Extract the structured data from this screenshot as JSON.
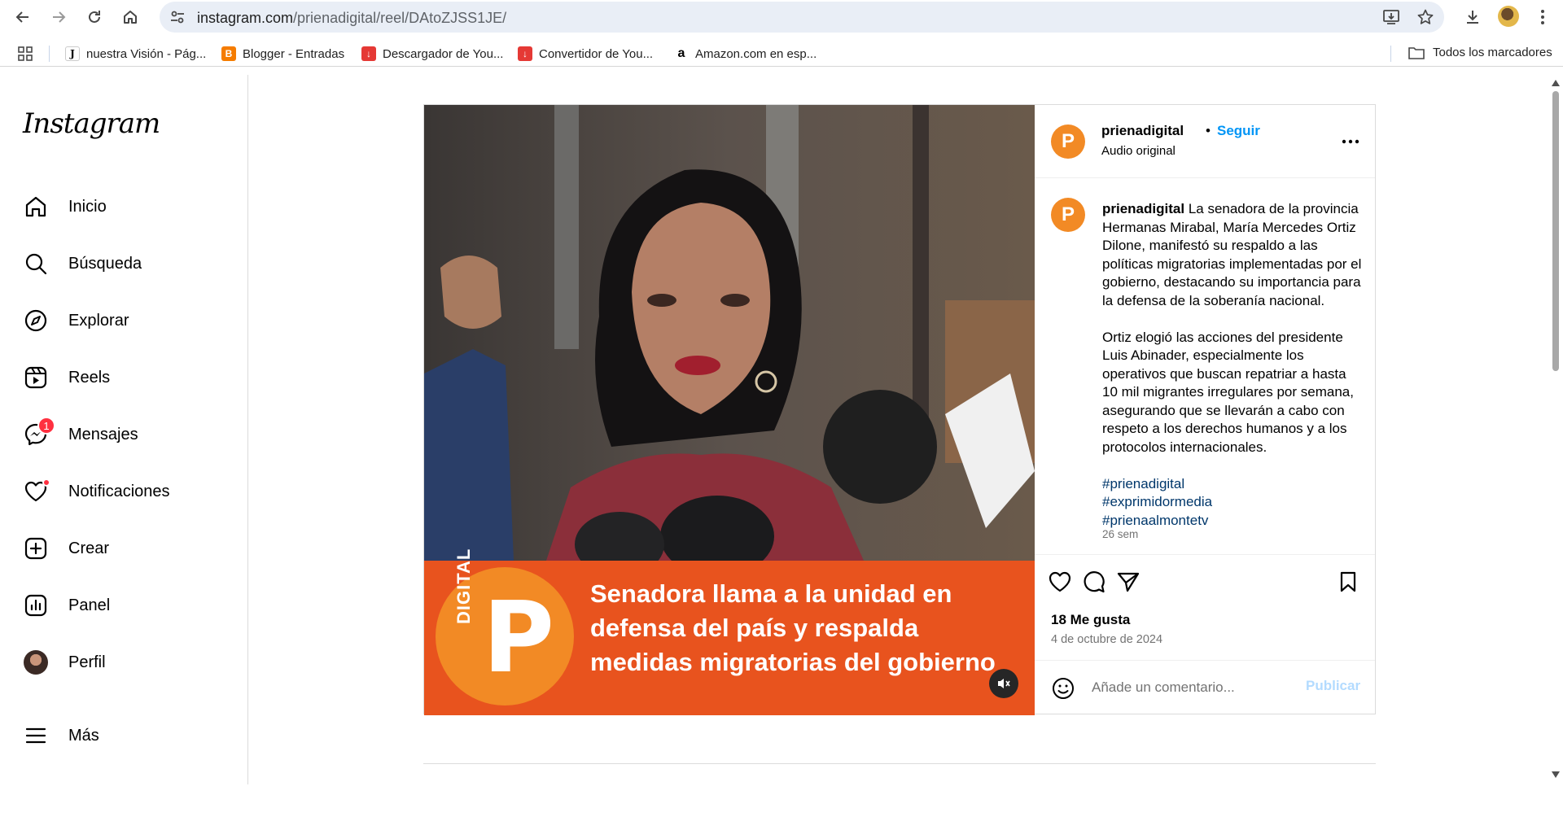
{
  "browser": {
    "url_domain": "instagram.com",
    "url_path": "/prienadigital/reel/DAtoZJSS1JE/",
    "bookmarks": [
      {
        "label": "nuestra Visión - Pág...",
        "fav": "J"
      },
      {
        "label": "Blogger - Entradas",
        "fav": "B"
      },
      {
        "label": "Descargador de You...",
        "fav": "↓"
      },
      {
        "label": "Convertidor de You...",
        "fav": "↓"
      },
      {
        "label": "Amazon.com en esp...",
        "fav": "a"
      }
    ],
    "all_bookmarks": "Todos los marcadores"
  },
  "sidebar": {
    "logo": "Instagram",
    "items": [
      {
        "label": "Inicio",
        "icon": "home-icon"
      },
      {
        "label": "Búsqueda",
        "icon": "search-icon"
      },
      {
        "label": "Explorar",
        "icon": "compass-icon"
      },
      {
        "label": "Reels",
        "icon": "reels-icon"
      },
      {
        "label": "Mensajes",
        "icon": "messenger-icon",
        "badge": "1"
      },
      {
        "label": "Notificaciones",
        "icon": "heart-icon"
      },
      {
        "label": "Crear",
        "icon": "create-icon"
      },
      {
        "label": "Panel",
        "icon": "dashboard-icon"
      },
      {
        "label": "Perfil",
        "icon": "avatar"
      },
      {
        "label": "Más",
        "icon": "menu-icon"
      }
    ]
  },
  "post": {
    "banner_text": "Senadora llama a la unidad en defensa del país y respalda medidas migratorias del gobierno",
    "logo_text": "DIGITAL",
    "logo_letter": "P",
    "header": {
      "username": "prienadigital",
      "separator": "•",
      "follow": "Seguir",
      "audio": "Audio original"
    },
    "caption": {
      "username": "prienadigital",
      "paragraph1": "La senadora de la provincia Hermanas Mirabal, María Mercedes Ortiz Dilone, manifestó su respaldo a las políticas migratorias implementadas por el gobierno, destacando su importancia para la defensa de la soberanía nacional.",
      "paragraph2": "Ortiz elogió las acciones del presidente Luis Abinader, especialmente los operativos que buscan repatriar a hasta 10 mil migrantes irregulares por semana, asegurando que se llevarán a cabo con respeto a los derechos humanos y a los protocolos internacionales.",
      "hashtags": [
        "#prienadigital",
        "#exprimidormedia",
        "#prienaalmontetv"
      ],
      "time": "26 sem"
    },
    "likes": "18 Me gusta",
    "date": "4 de octubre de 2024",
    "comment_placeholder": "Añade un comentario...",
    "publish": "Publicar"
  },
  "colors": {
    "accent_blue": "#0095f6",
    "banner_orange": "#e8531e",
    "logo_orange": "#f28a25",
    "badge_red": "#ff3040"
  }
}
